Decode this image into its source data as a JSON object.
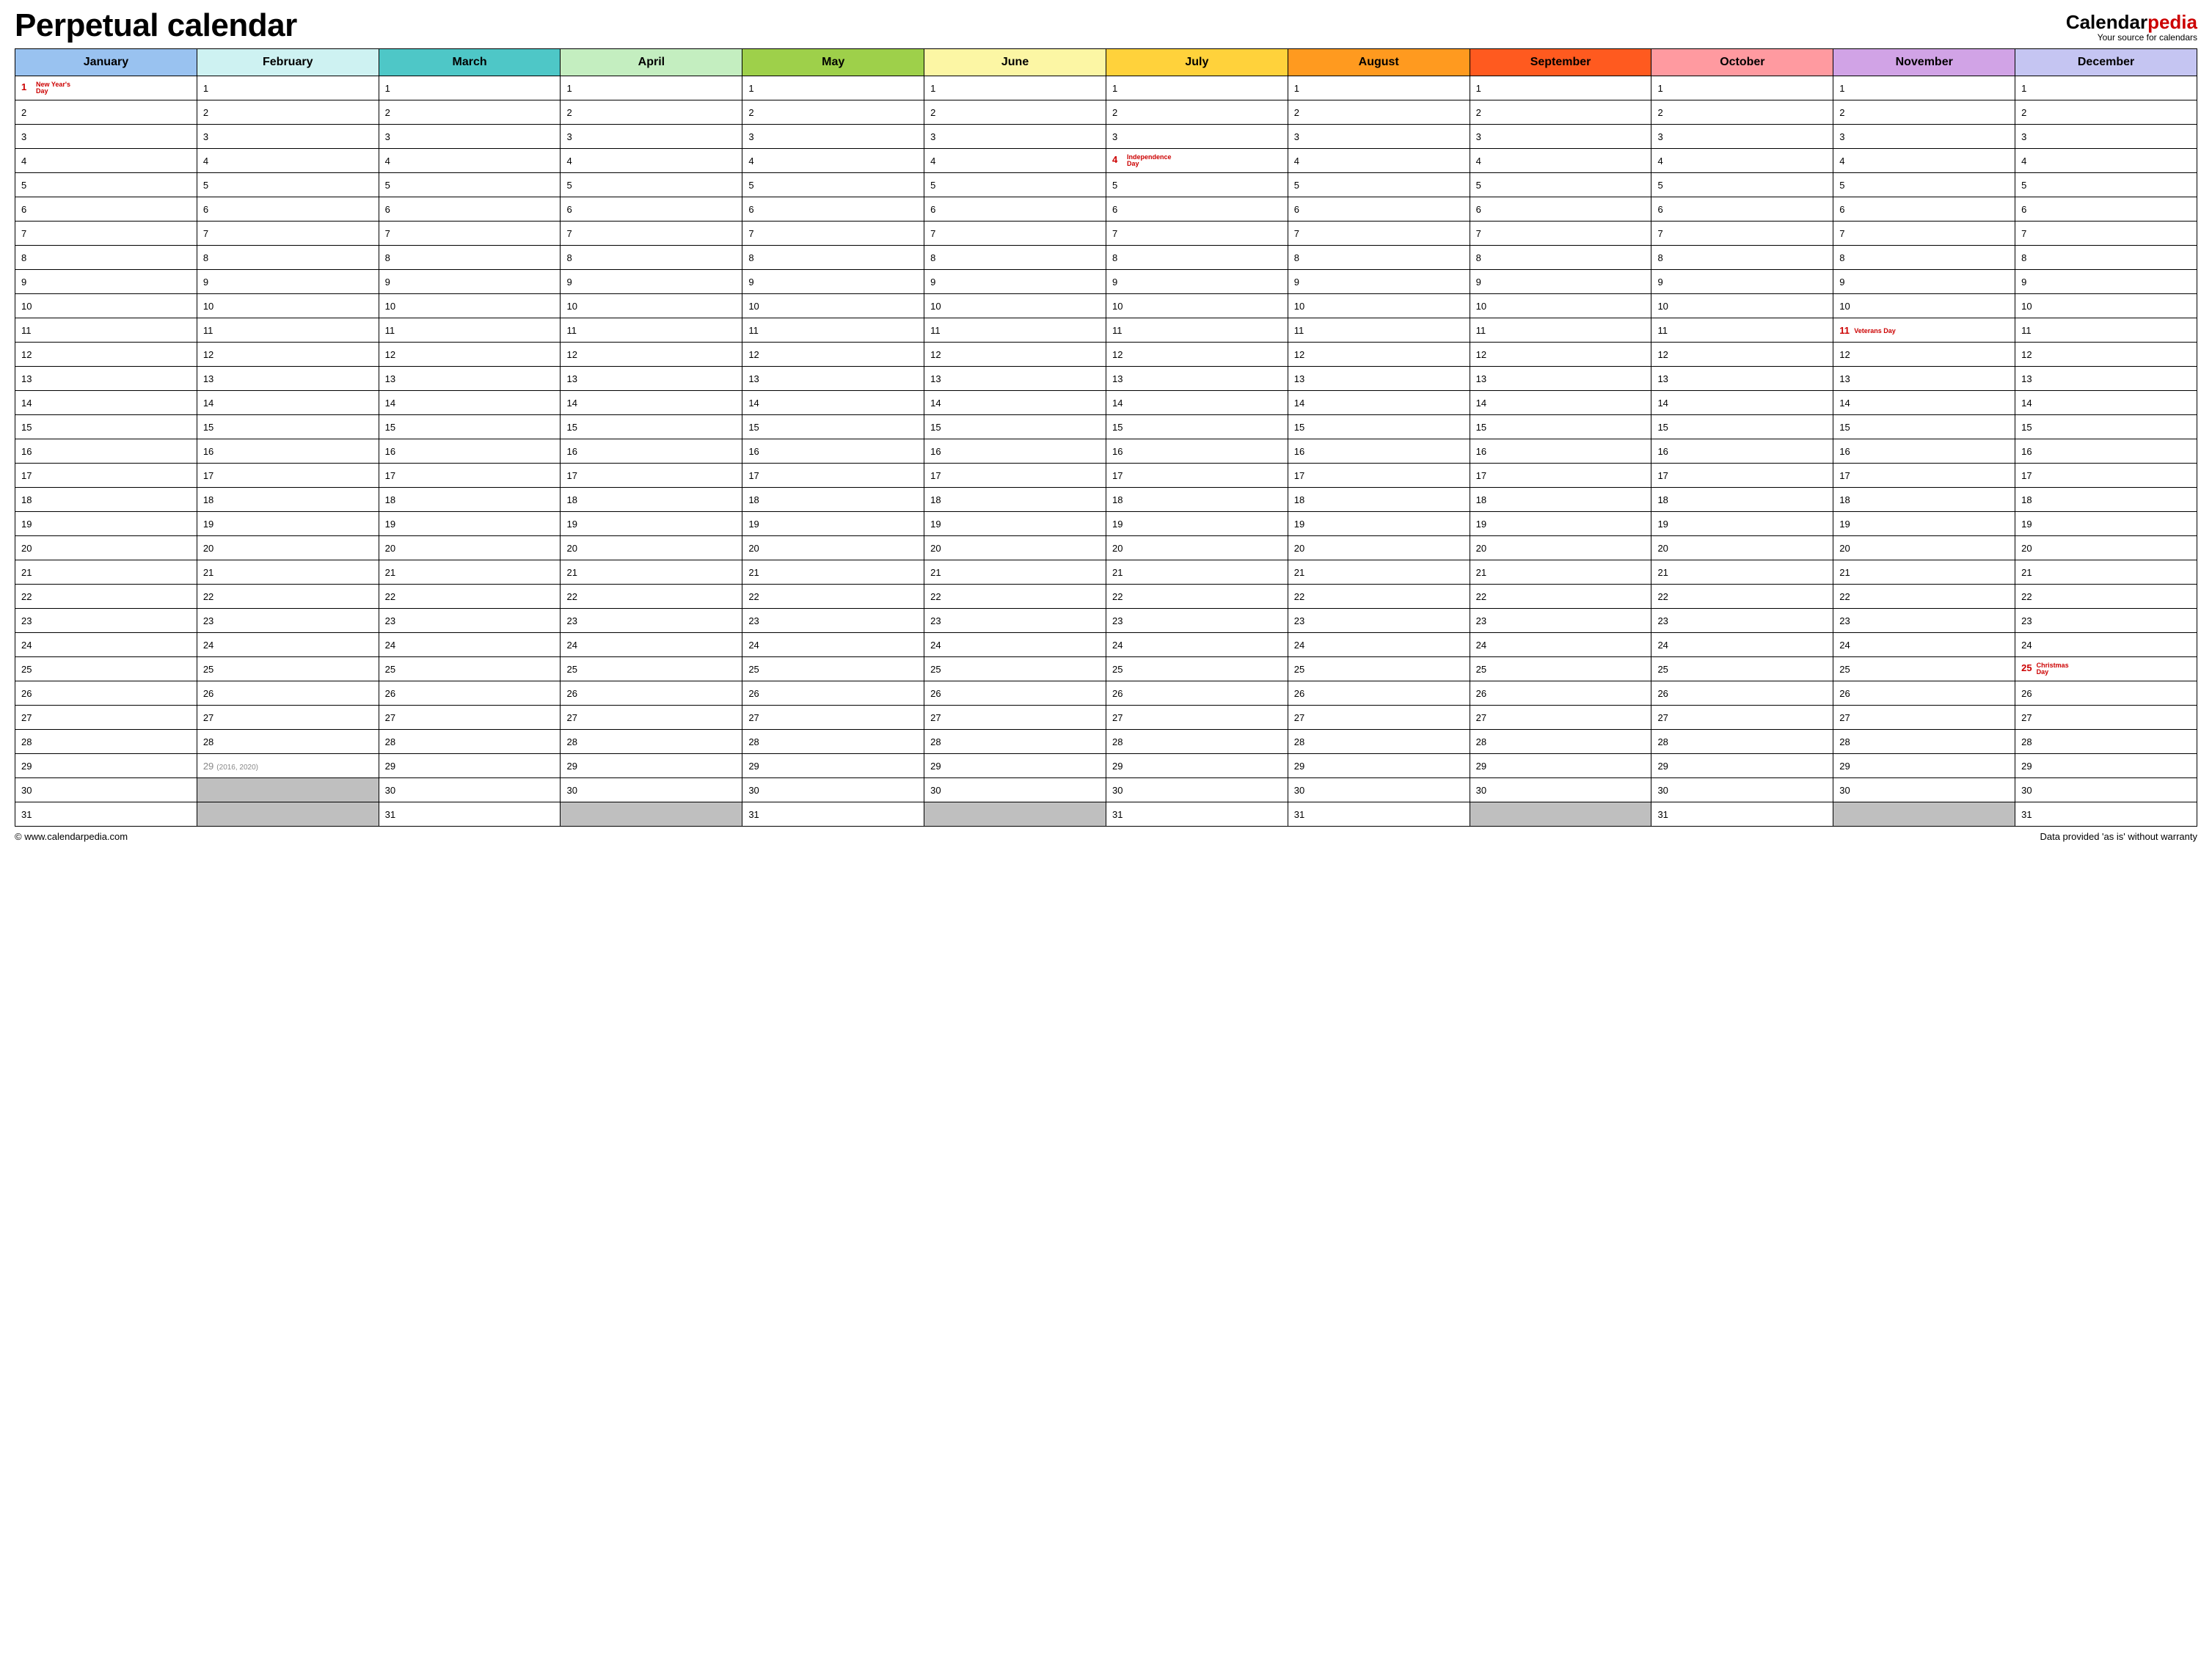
{
  "title": "Perpetual calendar",
  "brand": {
    "part1": "Calendar",
    "part2": "pedia",
    "tagline": "Your source for calendars"
  },
  "months": [
    {
      "name": "January",
      "color": "#99c2f0",
      "days": 31
    },
    {
      "name": "February",
      "color": "#cef2f2",
      "days": 29
    },
    {
      "name": "March",
      "color": "#4ec7c7",
      "days": 31
    },
    {
      "name": "April",
      "color": "#c4eec0",
      "days": 30
    },
    {
      "name": "May",
      "color": "#9ed04a",
      "days": 31
    },
    {
      "name": "June",
      "color": "#fcf6a4",
      "days": 30
    },
    {
      "name": "July",
      "color": "#ffd23b",
      "days": 31
    },
    {
      "name": "August",
      "color": "#ff9a1f",
      "days": 31
    },
    {
      "name": "September",
      "color": "#ff5a1f",
      "days": 30
    },
    {
      "name": "October",
      "color": "#ff9aa0",
      "days": 31
    },
    {
      "name": "November",
      "color": "#d1a3e6",
      "days": 30
    },
    {
      "name": "December",
      "color": "#c5c5f2",
      "days": 31
    }
  ],
  "holidays": [
    {
      "month": 0,
      "day": 1,
      "label": "New Year's Day"
    },
    {
      "month": 6,
      "day": 4,
      "label": "Independence Day"
    },
    {
      "month": 10,
      "day": 11,
      "label": "Veterans Day"
    },
    {
      "month": 11,
      "day": 25,
      "label": "Christmas Day"
    }
  ],
  "feb29": {
    "muted": true,
    "note": "(2016, 2020)"
  },
  "footer_left": "© www.calendarpedia.com",
  "footer_right": "Data provided 'as is' without warranty"
}
